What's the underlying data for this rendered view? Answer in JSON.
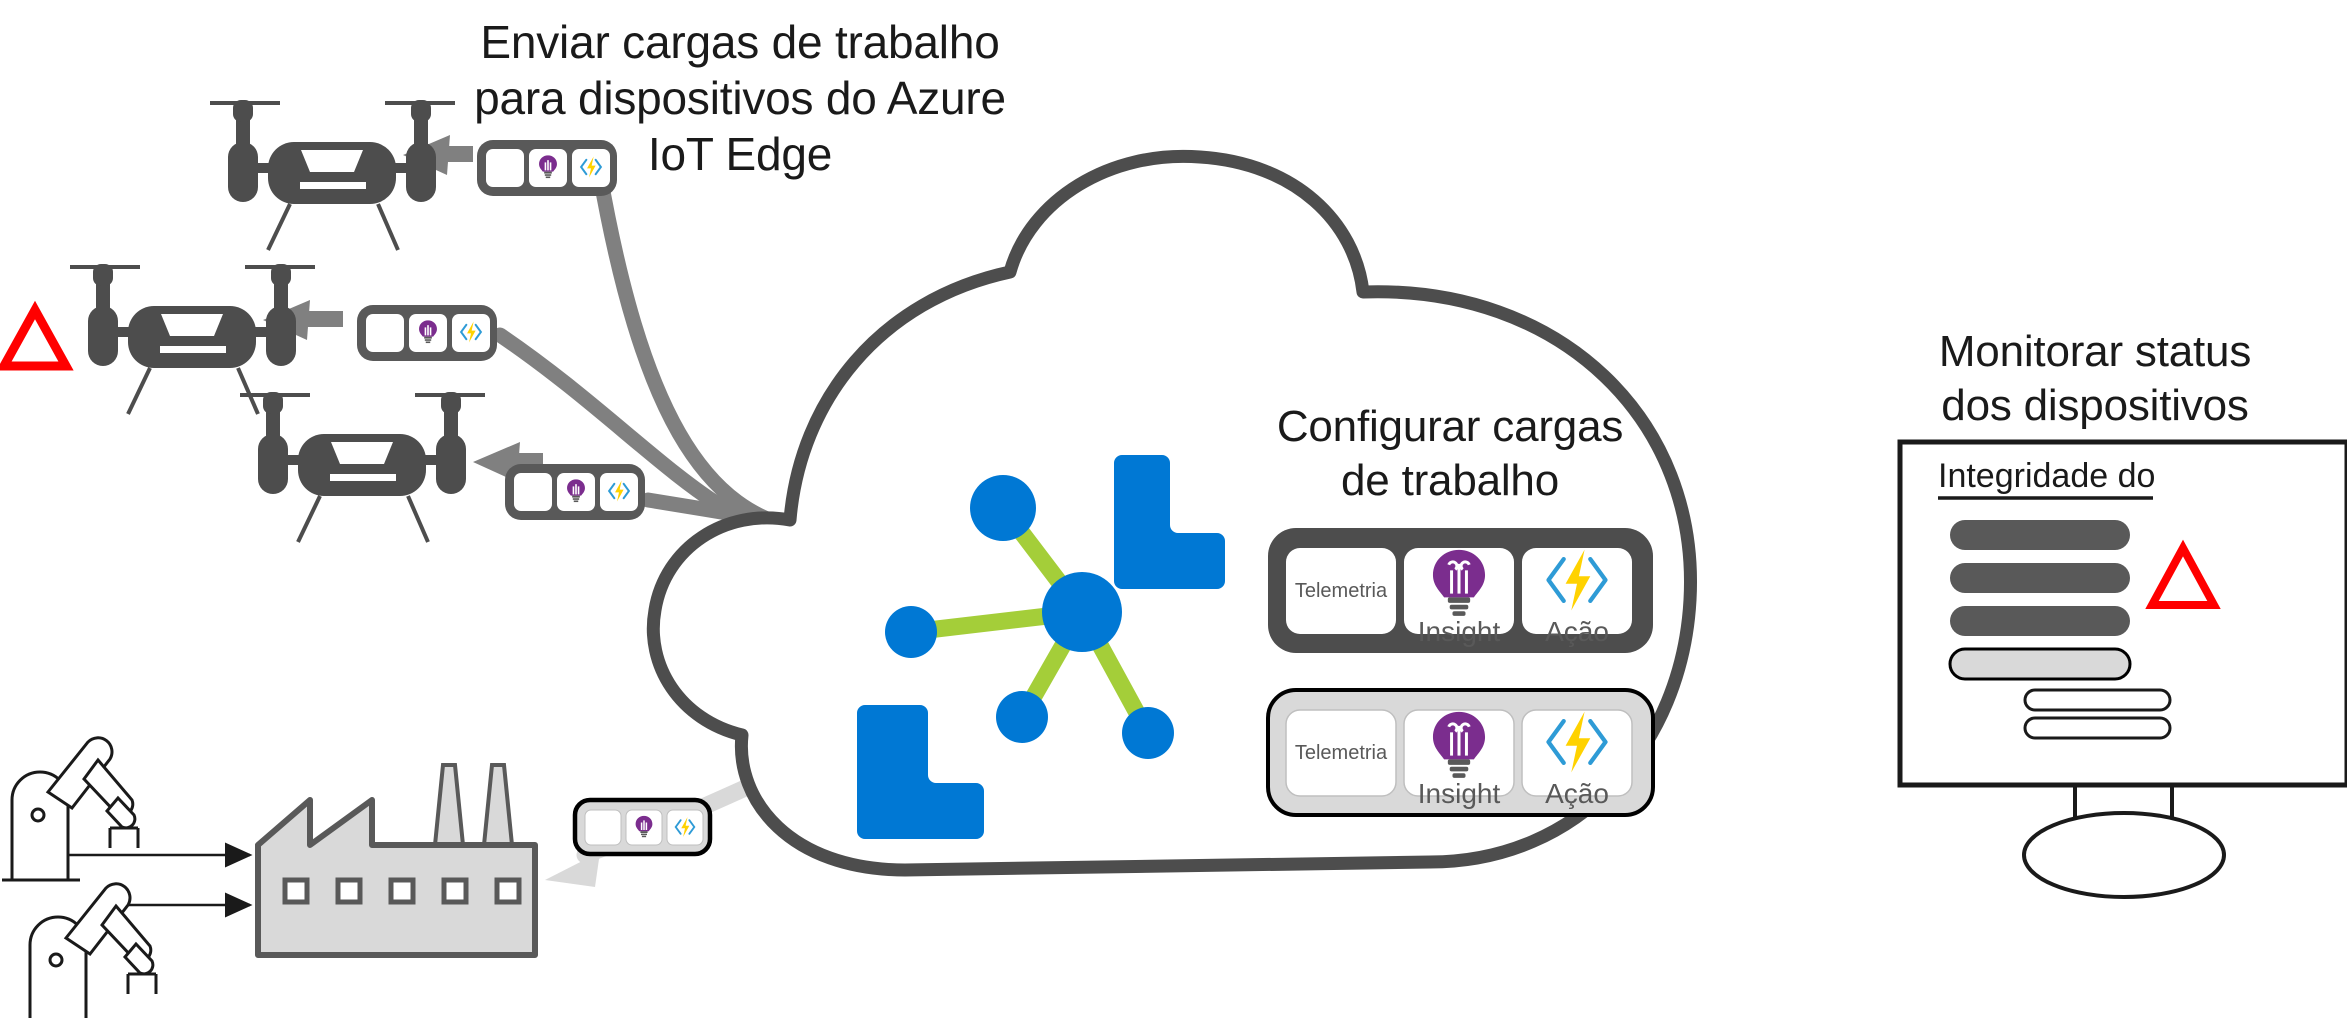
{
  "diagram": {
    "title_send": "Enviar cargas de trabalho\npara dispositivos do Azure\nIoT Edge",
    "title_configure": "Configurar cargas\nde trabalho",
    "title_monitor": "Monitorar status\ndos dispositivos"
  },
  "colors": {
    "cloud_stroke": "#4D4D4D",
    "connector_gray": "#808080",
    "connector_light": "#D9D9D9",
    "azure_blue": "#0078D4",
    "azure_green": "#A4CE39",
    "insight_purple": "#7B2D8E",
    "action_yellow": "#FFD200",
    "action_chevron_blue": "#2E9BD6",
    "alert_red": "#FF0000",
    "device_dark": "#4D4D4D",
    "factory_fill": "#D9D9D9",
    "module_bar_dark": "#4D4D4D",
    "module_bar_light": "#D9D9D9",
    "monitor_bar_dark": "#595959",
    "monitor_bar_light": "#D9D9D9",
    "text": "#1A1A1A"
  },
  "cloud": {
    "module_bars": [
      {
        "id": "module-bar-active",
        "style": "dark",
        "cells": [
          {
            "label": "Telemetria",
            "icon": "telemetry-text"
          },
          {
            "label": "Insight",
            "icon": "lightbulb-icon"
          },
          {
            "label": "Ação",
            "icon": "lightning-bolt-icon"
          }
        ]
      },
      {
        "id": "module-bar-secondary",
        "style": "light",
        "cells": [
          {
            "label": "Telemetria",
            "icon": "telemetry-text"
          },
          {
            "label": "Insight",
            "icon": "lightbulb-icon"
          },
          {
            "label": "Ação",
            "icon": "lightning-bolt-icon"
          }
        ]
      }
    ],
    "iot_hub_icon": {
      "name": "iot-hub-icon",
      "nodes": 5,
      "bracket_count": 2
    }
  },
  "devices": {
    "drones": [
      {
        "id": "drone-1",
        "alert": false
      },
      {
        "id": "drone-2",
        "alert": true
      },
      {
        "id": "drone-3",
        "alert": false
      }
    ],
    "factory": {
      "id": "factory",
      "windows": 5,
      "chimneys": 2
    },
    "robot_arms": 2,
    "edge_badges": [
      {
        "id": "edge-badge-1",
        "style": "dark",
        "cells": [
          "telemetry-blank",
          "lightbulb-icon",
          "lightning-bolt-icon"
        ]
      },
      {
        "id": "edge-badge-2",
        "style": "dark",
        "cells": [
          "telemetry-blank",
          "lightbulb-icon",
          "lightning-bolt-icon"
        ]
      },
      {
        "id": "edge-badge-3",
        "style": "dark",
        "cells": [
          "telemetry-blank",
          "lightbulb-icon",
          "lightning-bolt-icon"
        ]
      },
      {
        "id": "edge-badge-factory",
        "style": "outline",
        "cells": [
          "telemetry-blank",
          "lightbulb-icon",
          "lightning-bolt-icon"
        ]
      }
    ]
  },
  "monitor": {
    "screen_title": "Integridade do",
    "rows": [
      {
        "type": "dark"
      },
      {
        "type": "dark"
      },
      {
        "type": "dark"
      },
      {
        "type": "light-filled"
      },
      {
        "type": "outline"
      },
      {
        "type": "outline"
      }
    ],
    "alert_icon": "warning-triangle-icon"
  }
}
